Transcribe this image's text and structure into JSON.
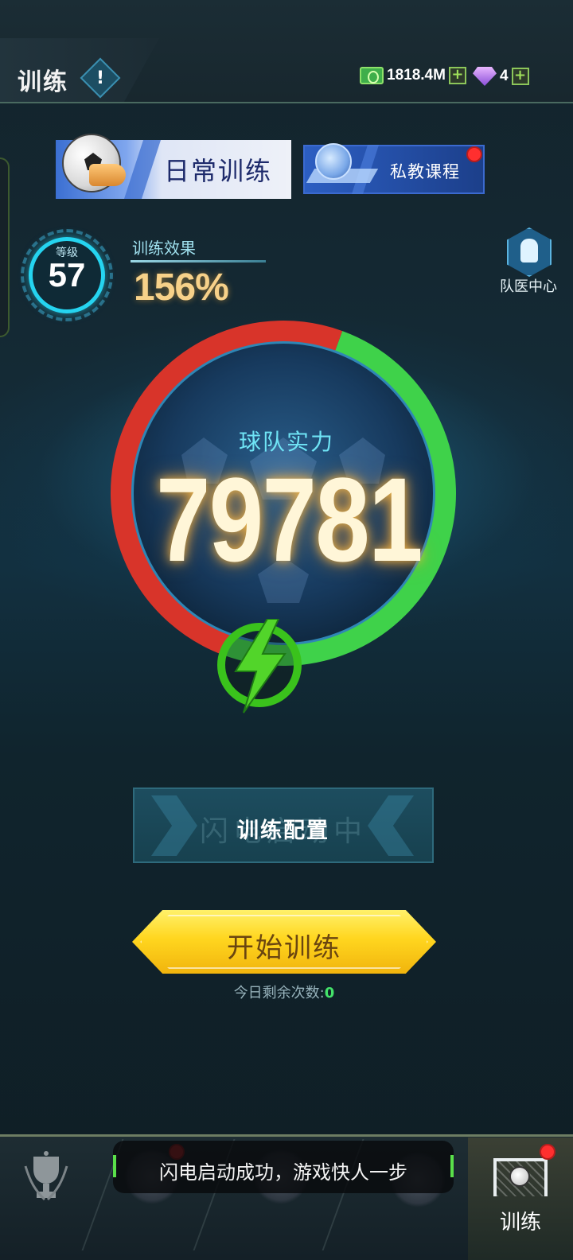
{
  "header": {
    "title": "训练",
    "cash_value": "1818.4M",
    "gem_value": "4"
  },
  "tabs": {
    "daily_label": "日常训练",
    "private_label": "私教课程"
  },
  "level": {
    "label": "等级",
    "value": "57"
  },
  "training_effect": {
    "label": "训练效果",
    "value": "156%"
  },
  "team_doctor": {
    "label": "队医中心"
  },
  "team_power": {
    "label": "球队实力",
    "value": "79781",
    "ring_green_fraction": 0.5,
    "ring_red_fraction": 0.5
  },
  "config_button": {
    "ghost_label": "闪电启动中",
    "label": "训练配置"
  },
  "start_button": {
    "label": "开始训练"
  },
  "remaining": {
    "label": "今日剩余次数:",
    "count": "0"
  },
  "bottom_nav": {
    "active_label": "训练"
  },
  "toast": {
    "text": "闪电启动成功，游戏快人一步"
  },
  "colors": {
    "ring_red": "#d8342a",
    "ring_green": "#3fd24a",
    "accent_cyan": "#25d4f0",
    "start_yellow": "#ffd61f"
  }
}
